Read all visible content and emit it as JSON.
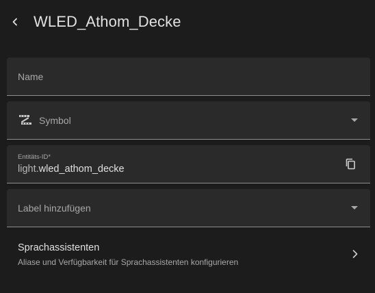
{
  "header": {
    "title": "WLED_Athom_Decke",
    "back_icon": "chevron-left-icon"
  },
  "fields": {
    "name": {
      "placeholder": "Name",
      "value": ""
    },
    "symbol": {
      "label": "Symbol",
      "icon": "led-strip-icon"
    },
    "entity_id": {
      "label": "Entitäts-ID*",
      "prefix": "light.",
      "value": "wled_athom_decke",
      "copy_icon": "copy-icon"
    },
    "labels": {
      "placeholder": "Label hinzufügen"
    }
  },
  "voice_assistants": {
    "title": "Sprachassistenten",
    "subtitle": "Aliase und Verfügbarkeit für Sprachassistenten konfigurieren"
  },
  "colors": {
    "background": "#1c1c1c",
    "field_background": "#2a2a2a",
    "text_primary": "#e1e1e1",
    "text_secondary": "#a8a8a8",
    "divider": "#8e8e8e"
  }
}
